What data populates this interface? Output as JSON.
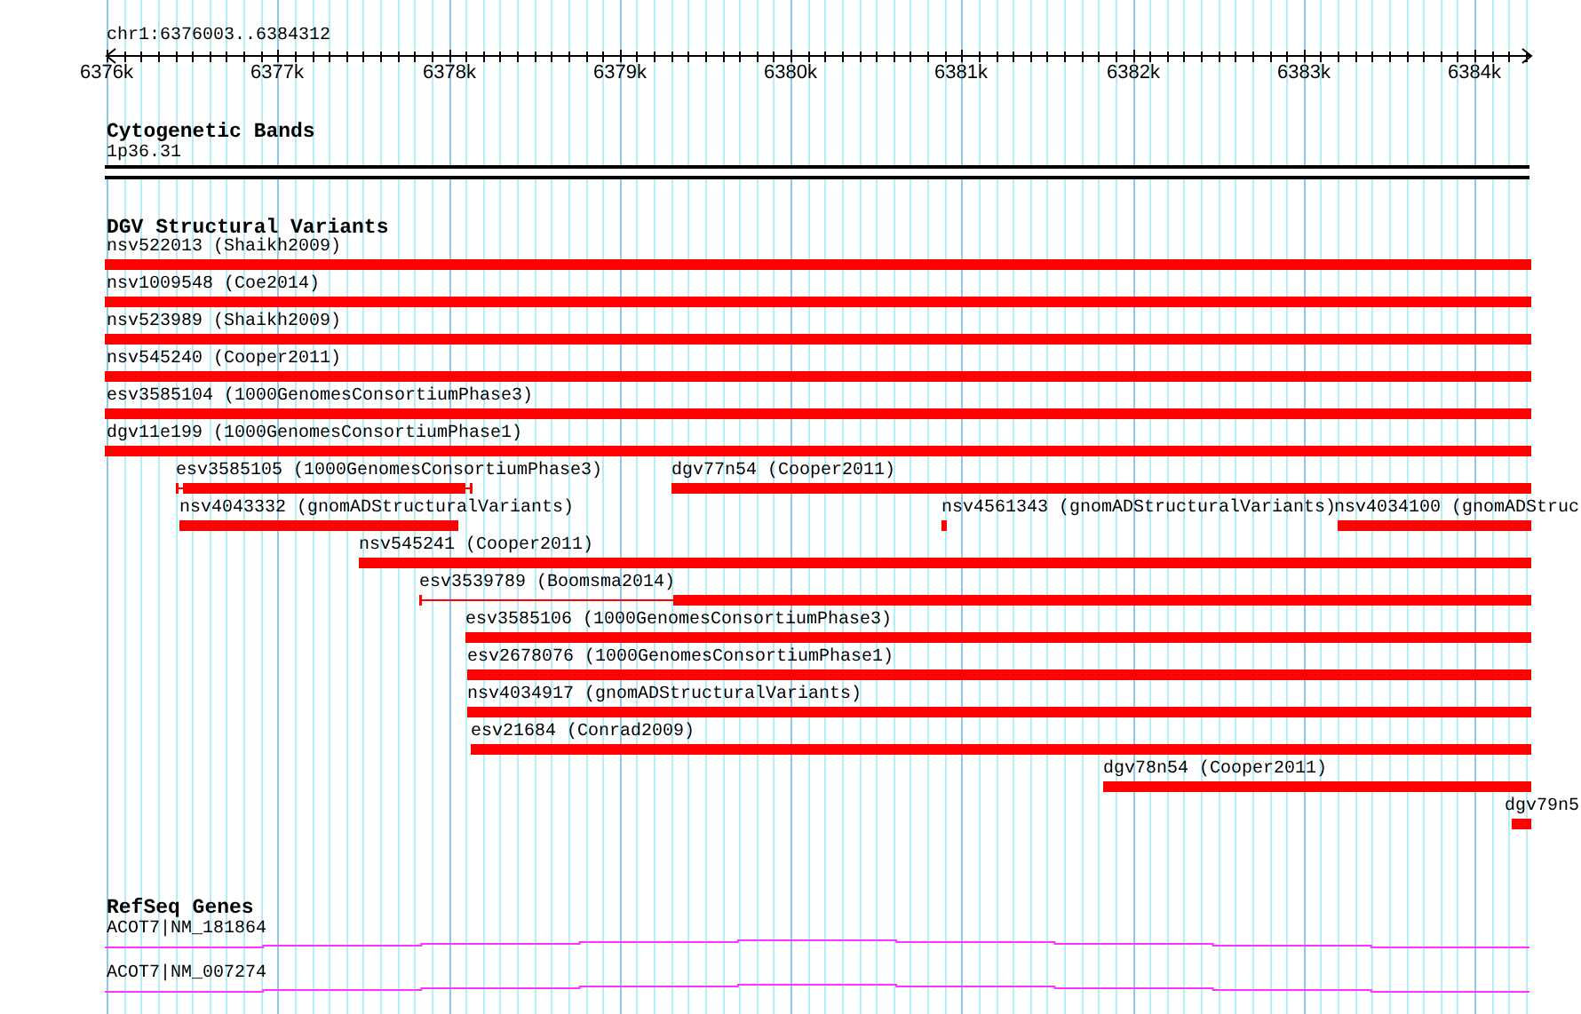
{
  "ruler": {
    "location": "chr1:6376003..6384312",
    "ticks": [
      "6376k",
      "6377k",
      "6378k",
      "6379k",
      "6380k",
      "6381k",
      "6382k",
      "6383k",
      "6384k"
    ]
  },
  "tracks": [
    {
      "title": "Cytogenetic Bands",
      "kind": "bands",
      "features": [
        {
          "label": "1p36.31"
        }
      ]
    },
    {
      "title": "DGV Structural Variants",
      "kind": "variants",
      "features": [
        {
          "label": "nsv522013 (Shaikh2009)"
        },
        {
          "label": "nsv1009548 (Coe2014)"
        },
        {
          "label": "nsv523989 (Shaikh2009)"
        },
        {
          "label": "nsv545240 (Cooper2011)"
        },
        {
          "label": "esv3585104 (1000GenomesConsortiumPhase3)"
        },
        {
          "label": "dgv11e199 (1000GenomesConsortiumPhase1)"
        },
        {
          "label": "esv3585105 (1000GenomesConsortiumPhase3)"
        },
        {
          "label": "dgv77n54 (Cooper2011)"
        },
        {
          "label": "nsv4043332 (gnomADStructuralVariants)"
        },
        {
          "label": "nsv4561343 (gnomADStructuralVariants)"
        },
        {
          "label": "nsv4034100 (gnomADStruc"
        },
        {
          "label": "nsv545241 (Cooper2011)"
        },
        {
          "label": "esv3539789 (Boomsma2014)"
        },
        {
          "label": "esv3585106 (1000GenomesConsortiumPhase3)"
        },
        {
          "label": "esv2678076 (1000GenomesConsortiumPhase1)"
        },
        {
          "label": "nsv4034917 (gnomADStructuralVariants)"
        },
        {
          "label": "esv21684 (Conrad2009)"
        },
        {
          "label": "dgv78n54 (Cooper2011)"
        },
        {
          "label": "dgv79n5"
        }
      ]
    },
    {
      "title": "RefSeq Genes",
      "kind": "genes",
      "features": [
        {
          "label": "ACOT7|NM_181864"
        },
        {
          "label": "ACOT7|NM_007274"
        }
      ]
    }
  ]
}
